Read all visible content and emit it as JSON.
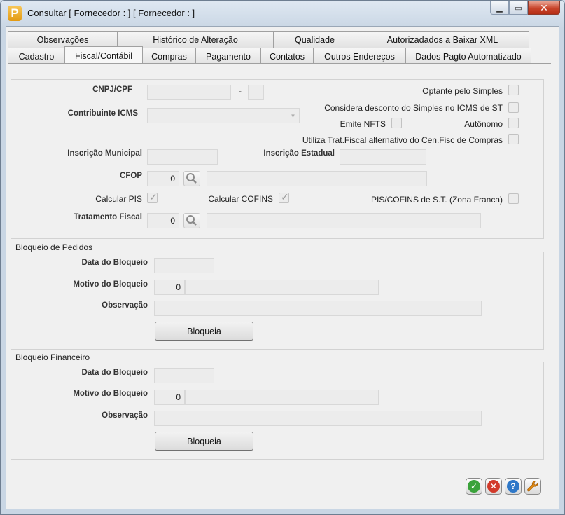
{
  "window": {
    "title": "Consultar  [ Fornecedor : ] [ Fornecedor : ]",
    "app_icon_letter": "P",
    "controls": {
      "minimize": "▁",
      "maximize": "▭",
      "close": "✕"
    }
  },
  "tabs_top": [
    "Observações",
    "Histórico de Alteração",
    "Qualidade",
    "Autorizadados a Baixar XML"
  ],
  "tabs_bottom": [
    "Cadastro",
    "Fiscal/Contábil",
    "Compras",
    "Pagamento",
    "Contatos",
    "Outros Endereços",
    "Dados Pagto Automatizado"
  ],
  "active_tab": "Fiscal/Contábil",
  "fiscal": {
    "cnpj_label": "CNPJ/CPF",
    "cnpj_separator": "-",
    "contribuinte_label": "Contribuinte ICMS",
    "optante_label": "Optante pelo Simples",
    "considera_label": "Considera desconto do Simples no ICMS de ST",
    "emite_nfts_label": "Emite NFTS",
    "autonomo_label": "Autônomo",
    "utiliza_label": "Utiliza Trat.Fiscal alternativo do Cen.Fisc de Compras",
    "inscricao_municipal_label": "Inscrição Municipal",
    "inscricao_estadual_label": "Inscrição Estadual",
    "cfop_label": "CFOP",
    "cfop_value": "0",
    "calcular_pis_label": "Calcular PIS",
    "calcular_cofins_label": "Calcular COFINS",
    "pis_cofins_st_label": "PIS/COFINS de S.T. (Zona Franca)",
    "tratamento_label": "Tratamento Fiscal",
    "tratamento_value": "0"
  },
  "bloqueio_pedidos": {
    "title": "Bloqueio de Pedidos",
    "data_label": "Data do Bloqueio",
    "motivo_label": "Motivo do Bloqueio",
    "motivo_value": "0",
    "observacao_label": "Observação",
    "button_label": "Bloqueia"
  },
  "bloqueio_financeiro": {
    "title": "Bloqueio Financeiro",
    "data_label": "Data do Bloqueio",
    "motivo_label": "Motivo do Bloqueio",
    "motivo_value": "0",
    "observacao_label": "Observação",
    "button_label": "Bloqueia"
  },
  "footer_buttons": {
    "ok_icon": "check-icon",
    "cancel_icon": "x-icon",
    "help_icon": "question-icon",
    "tools_icon": "wrench-icon",
    "ok_glyph": "✓",
    "cancel_glyph": "✕",
    "help_glyph": "?",
    "tools_glyph": "🔧"
  },
  "colors": {
    "ok": "#3aa23a",
    "cancel": "#d23a2a",
    "help": "#2f78c8",
    "tools": "#e08a14"
  }
}
